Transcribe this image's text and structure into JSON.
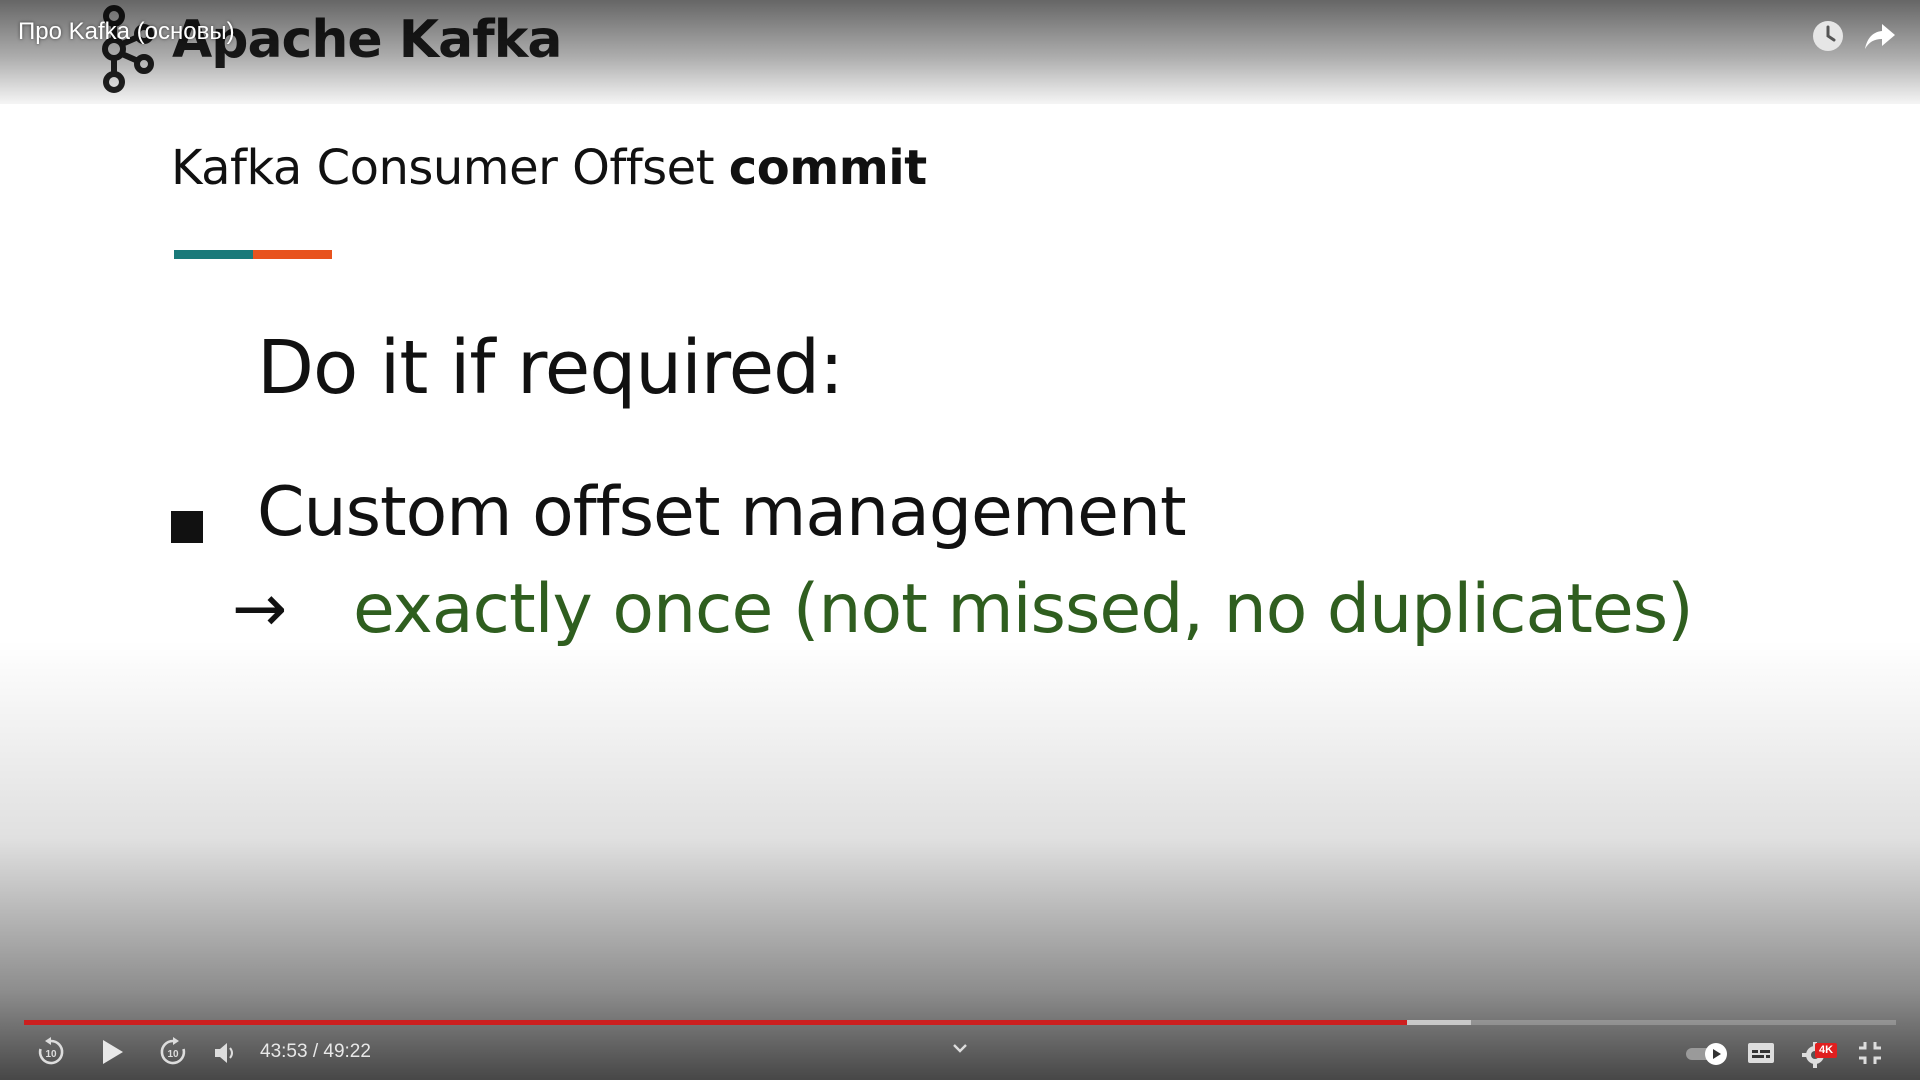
{
  "player": {
    "video_title": "Про Kafka (основы)",
    "time_current": "43:53",
    "time_separator": " / ",
    "time_total": "49:22",
    "progress": {
      "played": 0.739,
      "buffered": 0.773
    },
    "quality_badge": "4K",
    "icons": {
      "watch_later": "clock-icon",
      "share": "share-arrow-icon",
      "rewind": "rewind-10-icon",
      "play": "play-icon",
      "forward": "forward-10-icon",
      "volume": "volume-icon",
      "chevron": "chevron-down-icon",
      "autoplay": "autoplay-toggle-icon",
      "subtitles": "subtitles-icon",
      "settings": "gear-icon",
      "exit_fullscreen": "exit-fullscreen-icon"
    },
    "colors": {
      "accent": "#cc1f1f",
      "badge": "#e01f1f"
    }
  },
  "slide": {
    "logo_text": "Apache Kafka",
    "title_regular": "Kafka Consumer Offset ",
    "title_bold": "commit",
    "accent_colors": [
      "#1a7a7a",
      "#e8531e"
    ],
    "headline": "Do it if required:",
    "bullet": "Custom offset management",
    "arrow": "→",
    "sub_bullet": "exactly once (not missed, no duplicates)",
    "sub_bullet_color": "#2f5e1f"
  }
}
